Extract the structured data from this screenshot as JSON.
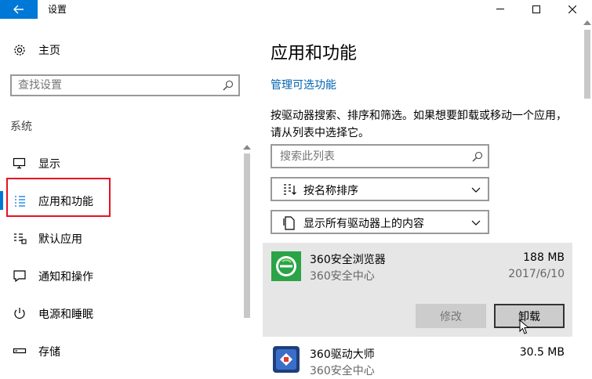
{
  "window": {
    "title": "设置",
    "accent_color": "#0078d7"
  },
  "sidebar": {
    "home_label": "主页",
    "search_placeholder": "查找设置",
    "section_title": "系统",
    "items": [
      {
        "label": "显示",
        "icon": "monitor-icon"
      },
      {
        "label": "应用和功能",
        "icon": "apps-list-icon",
        "active": true
      },
      {
        "label": "默认应用",
        "icon": "default-apps-icon"
      },
      {
        "label": "通知和操作",
        "icon": "notification-icon"
      },
      {
        "label": "电源和睡眠",
        "icon": "power-icon"
      },
      {
        "label": "存储",
        "icon": "storage-icon"
      }
    ]
  },
  "main": {
    "title": "应用和功能",
    "manage_link": "管理可选功能",
    "description": "按驱动器搜索、排序和筛选。如果想要卸载或移动一个应用，请从列表中选择它。",
    "search_placeholder": "搜索此列表",
    "sort_label": "按名称排序",
    "filter_label": "显示所有驱动器上的内容",
    "apps": [
      {
        "name": "360安全浏览器",
        "publisher": "360安全中心",
        "size": "188 MB",
        "date": "2017/6/10",
        "selected": true
      },
      {
        "name": "360驱动大师",
        "publisher": "360安全中心",
        "size": "30.5 MB"
      }
    ],
    "modify_label": "修改",
    "uninstall_label": "卸载"
  }
}
